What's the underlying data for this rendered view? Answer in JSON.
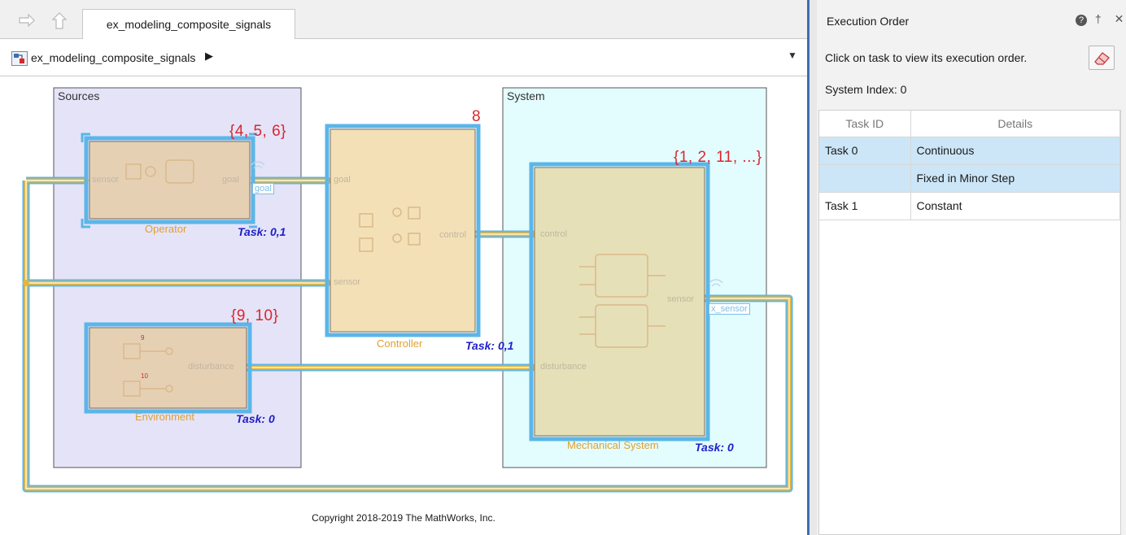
{
  "editor": {
    "tab_label": "ex_modeling_composite_signals",
    "breadcrumb": "ex_modeling_composite_signals"
  },
  "diagram": {
    "areas": {
      "sources": "Sources",
      "system": "System"
    },
    "blocks": {
      "operator": {
        "label": "Operator",
        "task": "Task: 0,1",
        "order": "{4, 5, 6}"
      },
      "controller": {
        "label": "Controller",
        "task": "Task: 0,1",
        "order": "8"
      },
      "environment": {
        "label": "Environment",
        "task": "Task: 0",
        "order": "{9, 10}"
      },
      "mechanical": {
        "label": "Mechanical System",
        "task": "Task: 0",
        "order": "{1, 2, 11, ...}"
      }
    },
    "ports": {
      "operator_in": "sensor",
      "operator_out": "goal",
      "controller_goal": "goal",
      "controller_sensor": "sensor",
      "controller_out": "control",
      "env_out": "disturbance",
      "mech_control": "control",
      "mech_disturbance": "disturbance",
      "mech_out": "sensor",
      "env_num_9": "9",
      "env_num_10": "10"
    },
    "tags": {
      "goal": "goal",
      "x_sensor": "x_sensor"
    },
    "copyright": "Copyright 2018-2019 The MathWorks, Inc."
  },
  "panel": {
    "title": "Execution Order",
    "instruction": "Click on task to view its execution order.",
    "system_index": "System Index: 0",
    "columns": [
      "Task ID",
      "Details"
    ],
    "rows": [
      {
        "task_id": "Task 0",
        "details": "Continuous"
      },
      {
        "task_id": "",
        "details": "Fixed in Minor Step"
      },
      {
        "task_id": "Task 1",
        "details": "Constant"
      }
    ]
  },
  "colors": {
    "signal_line": "#e8b43a",
    "highlight": "#5bb6e8",
    "task_label": "#2020c8",
    "order_label": "#d8272d"
  }
}
